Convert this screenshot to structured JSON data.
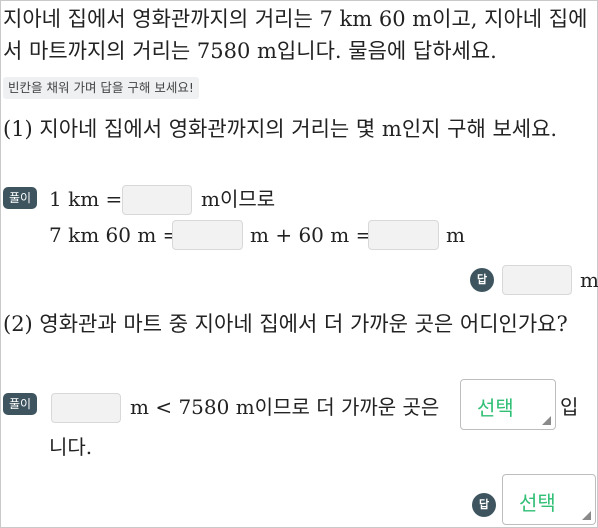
{
  "problem": {
    "text": "지아네 집에서 영화관까지의 거리는 7 km 60 m이고, 지아네 집에서 마트까지의 거리는 7580 m입니다. 물음에 답하세요."
  },
  "hint": "빈칸을 채워 가며 답을 구해 보세요!",
  "q1": {
    "question": "(1) 지아네 집에서 영화관까지의 거리는 몇 m인지 구해 보세요.",
    "solution_label": "풀이",
    "line1_pre": "1 km =",
    "line1_post": "m이므로",
    "line2_pre": "7 km 60 m =",
    "line2_mid": "m + 60 m =",
    "line2_post": "m",
    "answer_label": "답",
    "answer_unit": "m"
  },
  "q2": {
    "question": "(2) 영화관과 마트 중 지아네 집에서 더 가까운 곳은 어디인가요?",
    "solution_label": "풀이",
    "compare_text": "m < 7580 m이므로 더 가까운 곳은",
    "suffix1": "입",
    "suffix2": "니다.",
    "select_placeholder": "선택",
    "answer_label": "답",
    "answer_placeholder": "선택"
  }
}
